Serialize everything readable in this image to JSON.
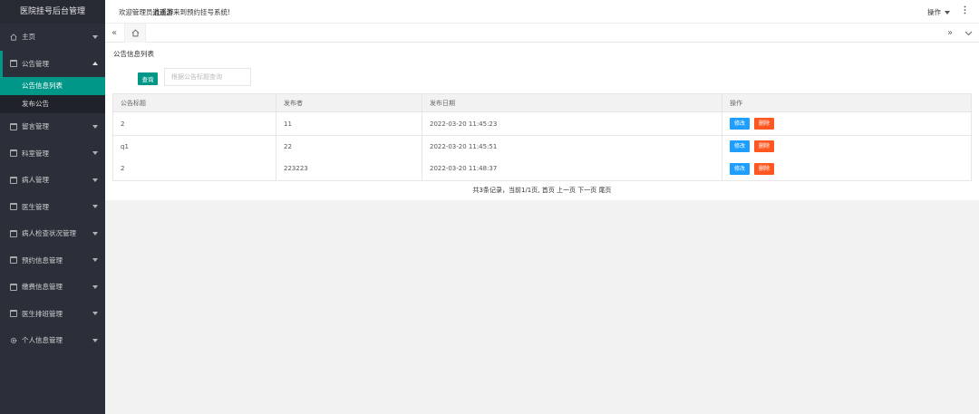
{
  "app": {
    "title": "医院挂号后台管理"
  },
  "header": {
    "welcome_prefix": "欢迎管理员",
    "admin_name": "逍遥游",
    "welcome_suffix": "来到预约挂号系统!",
    "ops_label": "操作",
    "more_icon": "⋮"
  },
  "sidebar": {
    "items": [
      {
        "label": "主页",
        "icon": "home-icon"
      },
      {
        "label": "公告管理",
        "icon": "calendar-icon",
        "open": true,
        "sub": [
          {
            "label": "公告信息列表",
            "active": true
          },
          {
            "label": "发布公告"
          }
        ]
      },
      {
        "label": "留言管理",
        "icon": "calendar-icon"
      },
      {
        "label": "科室管理",
        "icon": "calendar-icon"
      },
      {
        "label": "病人管理",
        "icon": "calendar-icon"
      },
      {
        "label": "医生管理",
        "icon": "calendar-icon"
      },
      {
        "label": "病人检查状况管理",
        "icon": "calendar-icon"
      },
      {
        "label": "预约信息管理",
        "icon": "calendar-icon"
      },
      {
        "label": "缴费信息管理",
        "icon": "calendar-icon"
      },
      {
        "label": "医生排班管理",
        "icon": "calendar-icon"
      },
      {
        "label": "个人信息管理",
        "icon": "gear-icon"
      }
    ]
  },
  "tabs": {
    "left_icon": "«",
    "right_icon": "»"
  },
  "main": {
    "card_title": "公告信息列表",
    "search_button": "查询",
    "search_placeholder": "根据公告标题查询",
    "columns": [
      "公告标题",
      "发布者",
      "发布日期",
      "操作"
    ],
    "rows": [
      {
        "title": "2",
        "publisher": "11",
        "date": "2022-03-20 11:45:23"
      },
      {
        "title": "q1",
        "publisher": "22",
        "date": "2022-03-20 11:45:51"
      },
      {
        "title": "2",
        "publisher": "223223",
        "date": "2022-03-20 11:48:37"
      }
    ],
    "edit_label": "修改",
    "delete_label": "删除",
    "pager": {
      "summary": "共3条记录，当前1/1页,",
      "first": "首页",
      "prev": "上一页",
      "next": "下一页",
      "last": "尾页"
    }
  },
  "colors": {
    "accent": "#009688",
    "sidebar_bg": "#2b2f3a",
    "edit": "#1e9fff",
    "delete": "#ff5722"
  }
}
